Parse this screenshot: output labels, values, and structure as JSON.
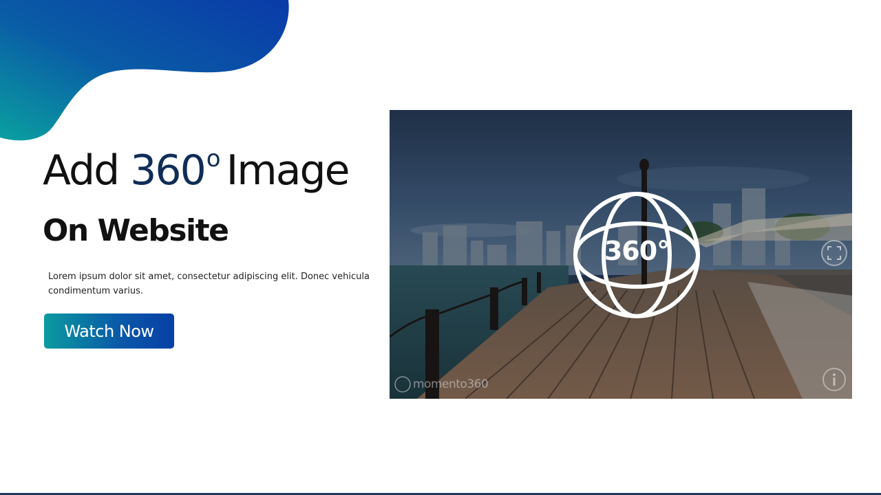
{
  "hero": {
    "title_prefix": "Add ",
    "title_number": "360",
    "title_degree": "o",
    "title_suffix": "Image",
    "subtitle": "On Website",
    "body": "Lorem ipsum dolor sit amet, consectetur adipiscing elit. Donec vehicula condimentum varius.",
    "cta_label": "Watch Now"
  },
  "viewer": {
    "badge_label": "360°",
    "watermark": "momento360",
    "icons": {
      "badge": "globe-360-icon",
      "fullscreen": "fullscreen-icon",
      "info": "info-icon"
    }
  },
  "colors": {
    "accent_dark": "#0f2d57",
    "gradient_teal": "#0b9aa0",
    "gradient_blue": "#0840a6"
  }
}
